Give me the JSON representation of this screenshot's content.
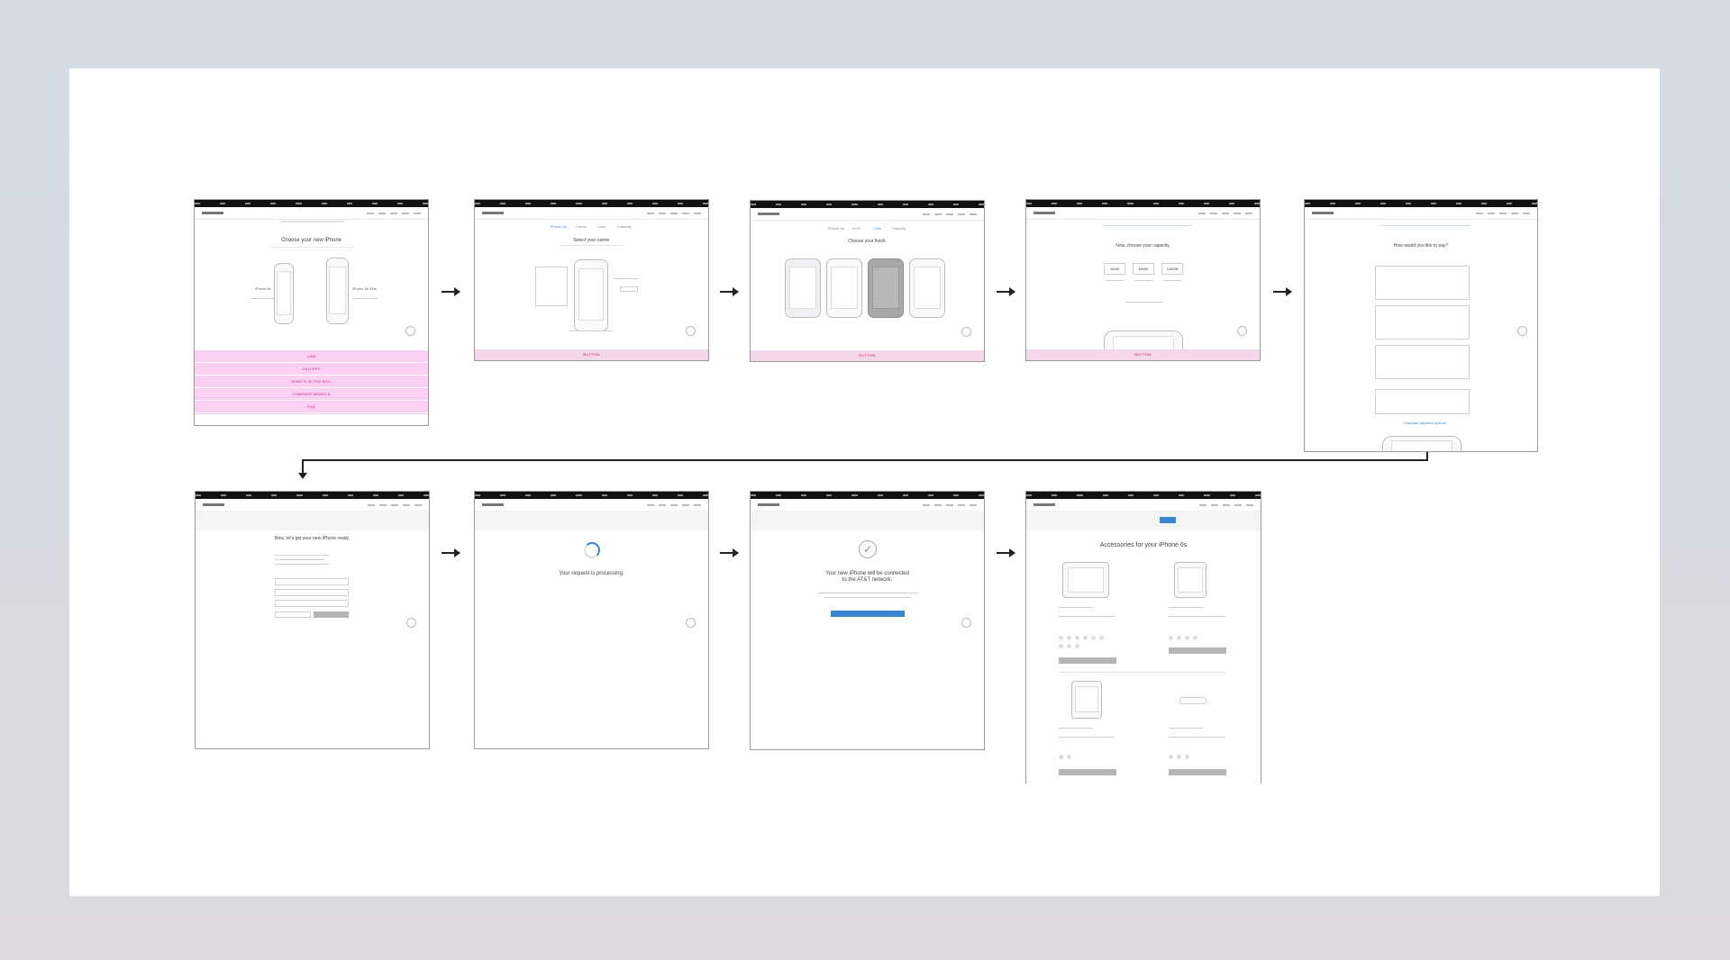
{
  "frames": {
    "f1": {
      "product": "iPhone 6 ⓔ",
      "title": "Choose your new iPhone",
      "model_a": "iPhone 6s",
      "model_b": "iPhone 6s Plus",
      "menu": [
        "CAM",
        "GALLERY",
        "WHAT'S IN THE BOX",
        "COMPARE MODELS",
        "FAQ"
      ]
    },
    "f2": {
      "product": "iPhone 6 ⓔ",
      "title": "Select your carrier",
      "tabs": [
        "iPhone 6s",
        "Carrier",
        "Color",
        "Capacity"
      ],
      "bottom": "BUTTON"
    },
    "f3": {
      "product": "iPhone 6 ⓔ",
      "title": "Choose your finish.",
      "tabs": [
        "iPhone 6s",
        "AT&T",
        "Color",
        "Capacity"
      ],
      "bottom": "BUTTON"
    },
    "f4": {
      "product": "iPhone 6 ⓔ",
      "title": "Now, choose your capacity.",
      "capacities": [
        "16GB",
        "64GB",
        "128GB"
      ],
      "bottom": "BUTTON"
    },
    "f5": {
      "product": "iPhone 6 ⓔ",
      "title": "How would you like to pay?",
      "link": "Compare payment options"
    },
    "f6": {
      "product": "iPhone 6 ⓔ",
      "title": "Now, let's get your new iPhone ready."
    },
    "f7": {
      "product": "iPhone 6 ⓔ",
      "title": "Your request is processing."
    },
    "f8": {
      "product": "iPhone 6 ⓔ",
      "title_line1": "Your new iPhone will be connected",
      "title_line2": "to the AT&T network.",
      "icon": "check-icon"
    },
    "f9": {
      "product": "iPhone 6 ⓔ",
      "title": "Accessories for your iPhone 6s"
    }
  }
}
